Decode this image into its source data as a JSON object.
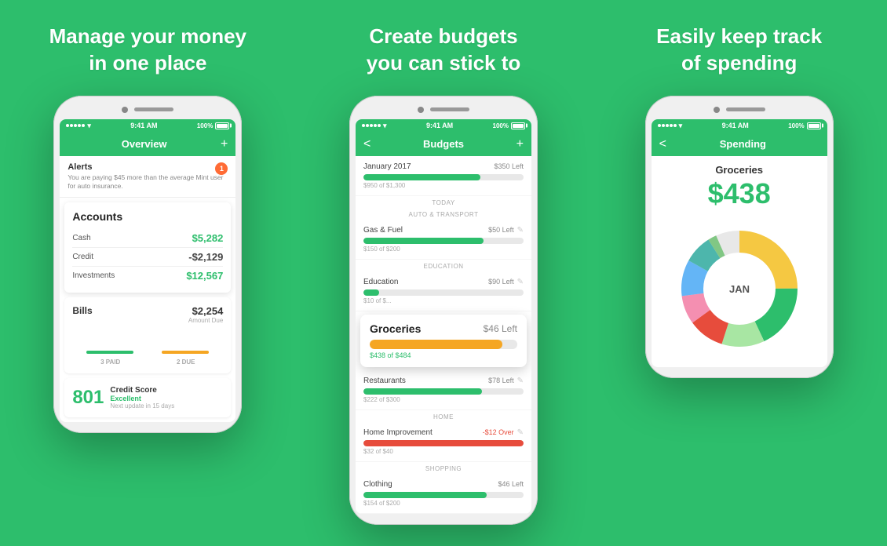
{
  "sections": [
    {
      "id": "section1",
      "title_line1": "Manage your money",
      "title_line2": "in one place",
      "phone": {
        "status": {
          "dots": 5,
          "wifi": "wifi",
          "time": "9:41 AM",
          "battery": "100%"
        },
        "header": {
          "back": null,
          "title": "Overview",
          "action": "+"
        },
        "alerts": {
          "title": "Alerts",
          "badge": "1",
          "text": "You are paying $45 more than the average Mint user for auto insurance."
        },
        "accounts": {
          "title": "Accounts",
          "rows": [
            {
              "name": "Cash",
              "amount": "$5,282",
              "positive": true
            },
            {
              "name": "Credit",
              "amount": "-$2,129",
              "positive": false
            },
            {
              "name": "Investments",
              "amount": "$12,567",
              "positive": true
            }
          ]
        },
        "bills": {
          "title": "Bills",
          "amount": "$2,254",
          "label": "Amount Due",
          "paid": "3 PAID",
          "due": "2 DUE"
        },
        "credit": {
          "score": "801",
          "rating": "Excellent",
          "next": "Next update in 15 days"
        }
      }
    },
    {
      "id": "section2",
      "title_line1": "Create budgets",
      "title_line2": "you can stick to",
      "phone": {
        "status": {
          "time": "9:41 AM",
          "battery": "100%"
        },
        "header": {
          "back": "<",
          "title": "Budgets",
          "action": "+"
        },
        "budget_items": [
          {
            "name": "January 2017",
            "left": "$350 Left",
            "sub": "$950 of $1,300",
            "percent": 73,
            "color": "#2dbe6c",
            "section_label": "TODAY"
          },
          {
            "name": "Gas & Fuel",
            "left": "$50 Left",
            "sub": "$150 of $200",
            "percent": 75,
            "color": "#2dbe6c",
            "section_label": "AUTO & TRANSPORT"
          },
          {
            "name": "Education",
            "left": "$90 Left",
            "sub": "$10 of $...",
            "percent": 10,
            "color": "#2dbe6c",
            "section_label": "EDUCATION"
          }
        ],
        "highlighted_budget": {
          "name": "Groceries",
          "left": "$46 Left",
          "sub": "$438 of $484",
          "percent": 90,
          "color": "#f5a623"
        },
        "budget_items_after": [
          {
            "name": "Restaurants",
            "left": "$78 Left",
            "sub": "$222 of $300",
            "percent": 74,
            "color": "#2dbe6c",
            "section_label": "HOME"
          },
          {
            "name": "Home Improvement",
            "left": "-$12 Over",
            "sub": "$32 of $40",
            "percent": 100,
            "color": "#e74c3c",
            "section_label": "SHOPPING"
          },
          {
            "name": "Clothing",
            "left": "$46 Left",
            "sub": "$154 of $200",
            "percent": 77,
            "color": "#2dbe6c",
            "section_label": null
          }
        ]
      }
    },
    {
      "id": "section3",
      "title_line1": "Easily keep track",
      "title_line2": "of spending",
      "phone": {
        "status": {
          "time": "9:41 AM",
          "battery": "100%"
        },
        "header": {
          "back": "<",
          "title": "Spending",
          "action": null
        },
        "spending": {
          "category": "Groceries",
          "amount": "$438",
          "chart_label": "JAN"
        }
      }
    }
  ]
}
